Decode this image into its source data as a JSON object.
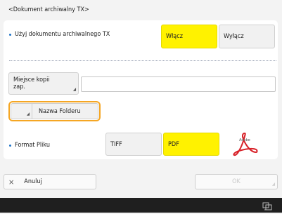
{
  "title": "<Dokument archiwalny TX>",
  "use_archive": {
    "label": "Użyj dokumentu archiwalnego TX",
    "on_label": "Włącz",
    "off_label": "Wyłącz"
  },
  "storage_location": {
    "button_label": "Miejsce kopii zap.",
    "value": ""
  },
  "folder_name": {
    "button_label": "Nazwa Folderu"
  },
  "file_format": {
    "label": "Format Pliku",
    "tiff_label": "TIFF",
    "pdf_label": "PDF"
  },
  "footer": {
    "cancel_label": "Anuluj",
    "ok_label": "OK"
  },
  "colors": {
    "selected": "#fff200",
    "focus_outline": "#f5a623",
    "bullet": "#1e73c8"
  },
  "icons": {
    "cancel": "close-icon",
    "adobe": "adobe-acrobat-icon",
    "status": "network-status-icon"
  }
}
